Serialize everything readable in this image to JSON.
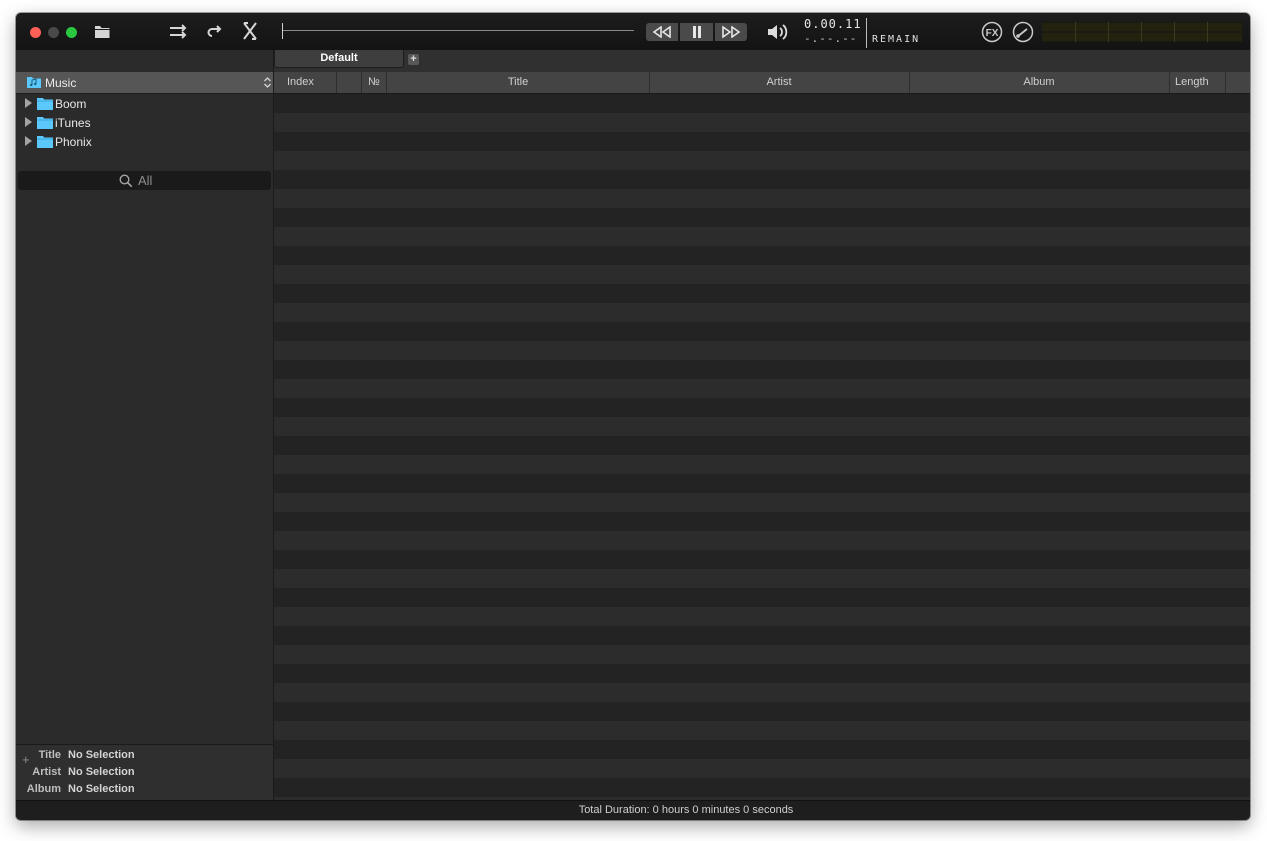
{
  "toolbar": {
    "time_main": "0.00.11",
    "time_sub": "-.--.--",
    "remain_label": "REMAIN",
    "fx_label": "FX"
  },
  "tabs": [
    {
      "label": "Default",
      "active": true
    }
  ],
  "tab_add_label": "+",
  "sidebar": {
    "source": "Music",
    "tree": [
      {
        "label": "Boom"
      },
      {
        "label": "iTunes"
      },
      {
        "label": "Phonix"
      }
    ],
    "search_placeholder": "All"
  },
  "info": {
    "rows": [
      {
        "key": "Title",
        "value": "No Selection"
      },
      {
        "key": "Artist",
        "value": "No Selection"
      },
      {
        "key": "Album",
        "value": "No Selection"
      }
    ]
  },
  "table": {
    "columns": [
      "Index",
      "№",
      "Title",
      "Artist",
      "Album",
      "Length"
    ],
    "rows": []
  },
  "status": {
    "total_duration": "Total Duration: 0 hours 0 minutes 0 seconds"
  },
  "colors": {
    "close": "#fe5f57",
    "minimize": "#4a4a4a",
    "zoom": "#2ac840",
    "folder": "#5ac8fa"
  }
}
